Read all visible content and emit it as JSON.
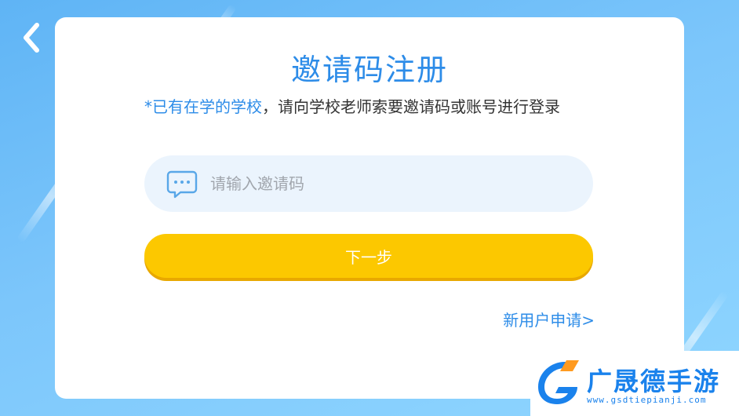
{
  "page": {
    "title": "邀请码注册",
    "notice_highlight": "*已有在学的学校",
    "notice_text": "，请向学校老师索要邀请码或账号进行登录"
  },
  "invite_input": {
    "placeholder": "请输入邀请码",
    "value": ""
  },
  "next_button": {
    "label": "下一步"
  },
  "register_link": {
    "label": "新用户申请>"
  },
  "watermark": {
    "brand": "广晟德手游",
    "domain": "www.gsdtiepianji.com"
  },
  "icons": {
    "back": "chevron-left-icon",
    "input": "message-icon"
  },
  "colors": {
    "accent": "#2d8ce8",
    "button": "#fcc800",
    "input_bg": "#ebf4fd"
  }
}
